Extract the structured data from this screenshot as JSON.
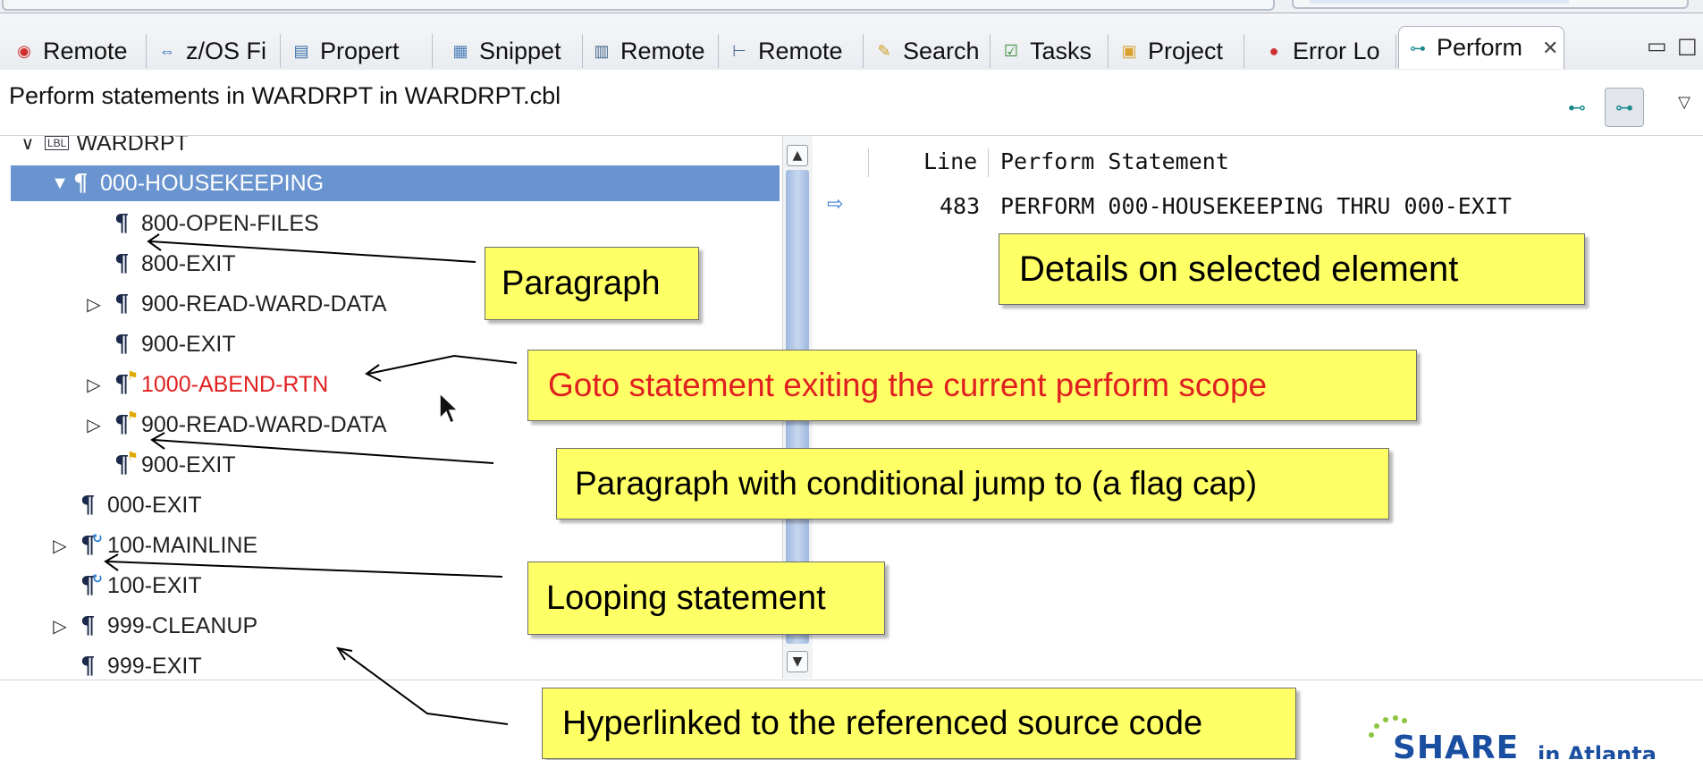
{
  "tabs": [
    {
      "label": "Remote",
      "icon": "remote-error-icon"
    },
    {
      "label": "z/OS Fi",
      "icon": "zos-files-icon"
    },
    {
      "label": "Propert",
      "icon": "properties-icon"
    },
    {
      "label": "Snippet",
      "icon": "snippet-icon"
    },
    {
      "label": "Remote",
      "icon": "remote-console-icon"
    },
    {
      "label": "Remote",
      "icon": "remote-tree-icon"
    },
    {
      "label": "Search",
      "icon": "search-icon"
    },
    {
      "label": "Tasks",
      "icon": "tasks-icon"
    },
    {
      "label": "Project",
      "icon": "project-icon"
    },
    {
      "label": "Error Lo",
      "icon": "error-log-icon"
    },
    {
      "label": "Perform",
      "icon": "perform-hierarchy-icon",
      "active": true
    }
  ],
  "header": {
    "description": "Perform statements in WARDRPT in WARDRPT.cbl"
  },
  "tree": {
    "root": "WARDRPT",
    "root_badge": "LBL",
    "items": [
      {
        "label": "000-HOUSEKEEPING",
        "selected": true
      },
      {
        "label": "800-OPEN-FILES"
      },
      {
        "label": "800-EXIT"
      },
      {
        "label": "900-READ-WARD-DATA"
      },
      {
        "label": "900-EXIT"
      },
      {
        "label": "1000-ABEND-RTN",
        "color": "#e02020"
      },
      {
        "label": "900-READ-WARD-DATA"
      },
      {
        "label": "900-EXIT"
      },
      {
        "label": "000-EXIT"
      },
      {
        "label": "100-MAINLINE"
      },
      {
        "label": "100-EXIT"
      },
      {
        "label": "999-CLEANUP"
      },
      {
        "label": "999-EXIT"
      }
    ]
  },
  "table": {
    "columns": [
      "Line",
      "Perform Statement"
    ],
    "rows": [
      {
        "line": "483",
        "statement": "PERFORM 000-HOUSEKEEPING THRU 000-EXIT"
      }
    ]
  },
  "callouts": {
    "paragraph": "Paragraph",
    "details": "Details on selected element",
    "goto": "Goto statement exiting the current perform scope",
    "conditional": "Paragraph with conditional jump to (a flag cap)",
    "looping": "Looping statement",
    "hyperlink": "Hyperlinked to the referenced source code"
  },
  "logo": {
    "word": "SHARE",
    "sub": "in Atlanta"
  },
  "colors": {
    "selection": "#6a94cf",
    "callout": "#ffff66",
    "goto_text": "#e02020"
  }
}
